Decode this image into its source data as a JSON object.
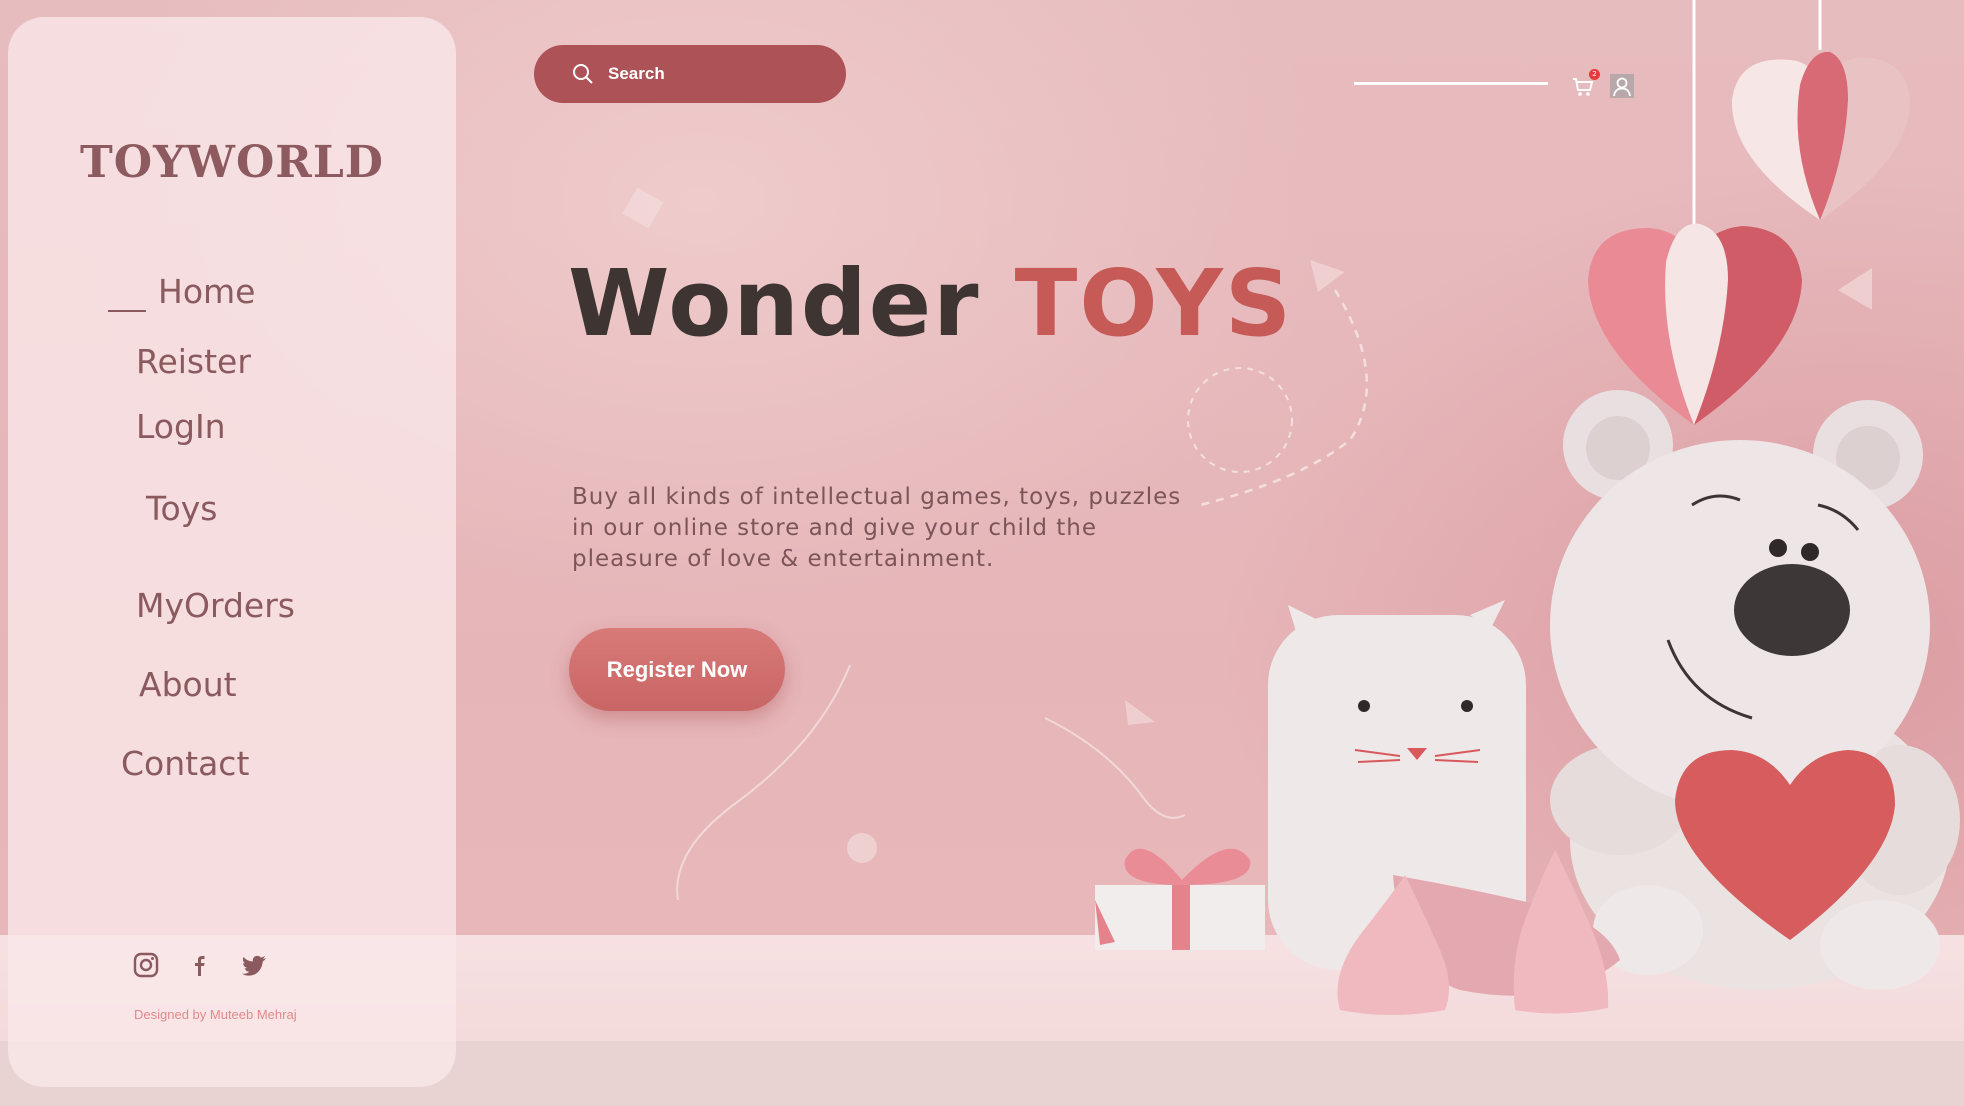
{
  "brand": {
    "logo": "TOYWORLD"
  },
  "nav": {
    "items": [
      {
        "label": "Home",
        "active": true
      },
      {
        "label": "Reister"
      },
      {
        "label": "LogIn"
      },
      {
        "label": "Toys"
      },
      {
        "label": "MyOrders"
      },
      {
        "label": "About"
      },
      {
        "label": "Contact"
      }
    ]
  },
  "header": {
    "search_placeholder": "Search",
    "cart_count": "2"
  },
  "hero": {
    "title_part1": "Wonder",
    "title_part2": "TOYS",
    "description": "Buy all kinds of intellectual games, toys, puzzles in our online store and give your child the pleasure of love & entertainment.",
    "cta_label": "Register Now"
  },
  "footer": {
    "socials": [
      "instagram-icon",
      "facebook-icon",
      "twitter-icon"
    ],
    "credit": "Designed by Muteeb Mehraj"
  },
  "colors": {
    "accent": "#ad5256",
    "brand_text": "#8c5a5f",
    "title_dark": "#3e3532",
    "title_red": "#c55a56",
    "sidebar_bg": "#fae8e9"
  }
}
